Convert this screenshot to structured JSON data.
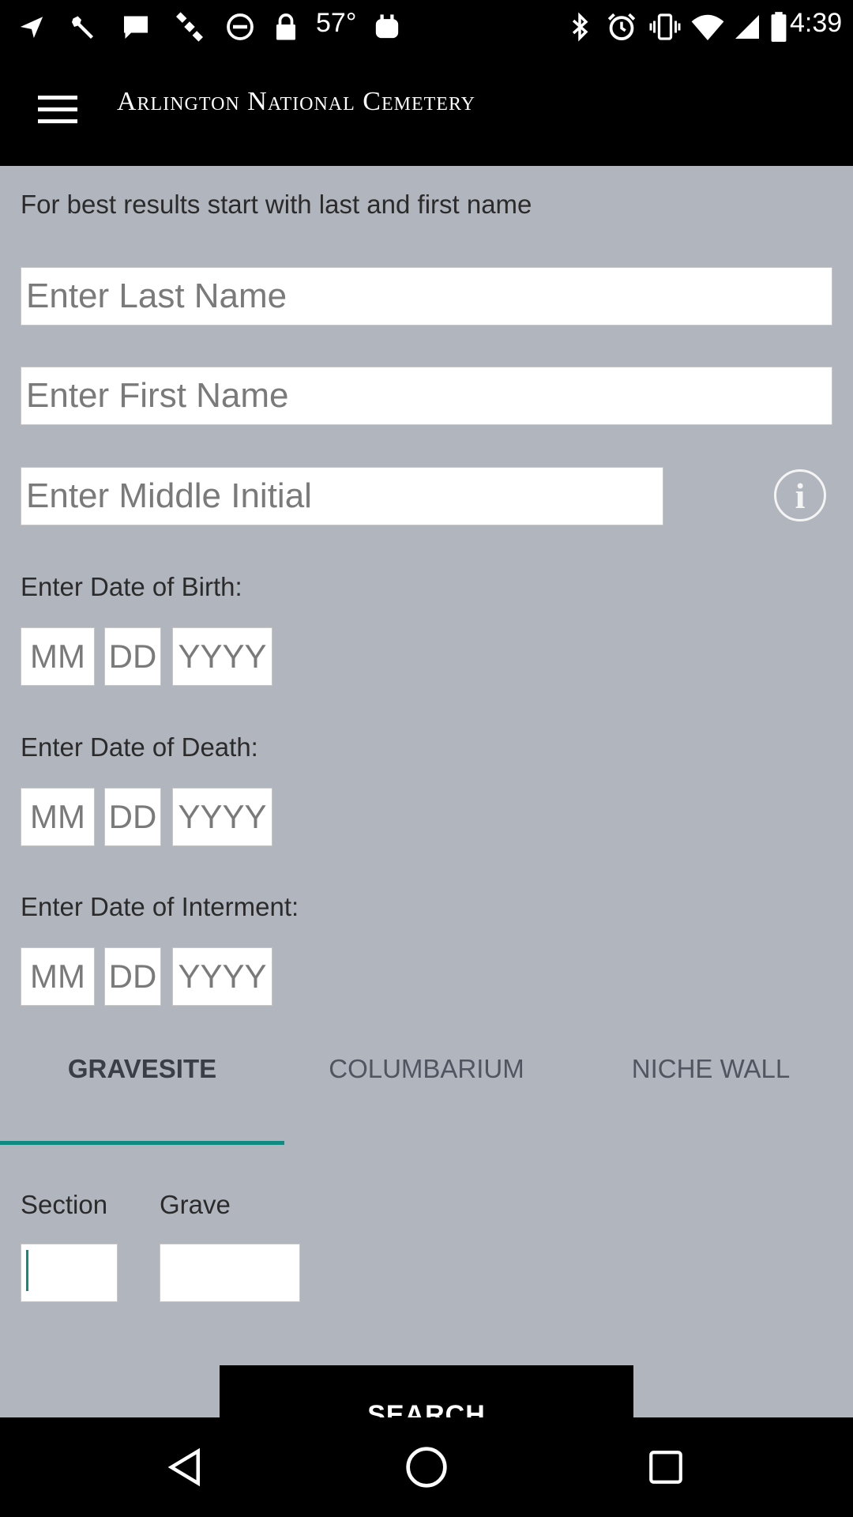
{
  "status_bar": {
    "temperature": "57°",
    "time": "4:39",
    "icons": [
      "send-icon",
      "wrench-icon",
      "message-icon",
      "satellite-icon",
      "dnd-icon",
      "lock-icon",
      "app-icon",
      "bluetooth-icon",
      "alarm-icon",
      "vibrate-icon",
      "wifi-icon",
      "signal-icon",
      "battery-icon"
    ]
  },
  "header": {
    "title": "Arlington National Cemetery",
    "menu_icon": "hamburger-menu-icon"
  },
  "form": {
    "hint": "For best results start with last and first name",
    "last_name_placeholder": "Enter Last Name",
    "first_name_placeholder": "Enter First Name",
    "middle_initial_placeholder": "Enter Middle Initial",
    "info_icon_glyph": "i",
    "birth_label": "Enter Date of Birth:",
    "death_label": "Enter Date of Death:",
    "interment_label": "Enter Date of Interment:",
    "month_placeholder": "MM",
    "day_placeholder": "DD",
    "year_placeholder": "YYYY"
  },
  "tabs": {
    "items": [
      "GRAVESITE",
      "COLUMBARIUM",
      "NICHE WALL"
    ],
    "active": "GRAVESITE",
    "accent_color": "#118b82"
  },
  "location": {
    "section_label": "Section",
    "grave_label": "Grave",
    "section_value": "",
    "grave_value": ""
  },
  "search_button": "SEARCH",
  "nav_bar": {
    "icons": [
      "back-triangle-icon",
      "home-circle-icon",
      "recents-square-icon"
    ]
  }
}
